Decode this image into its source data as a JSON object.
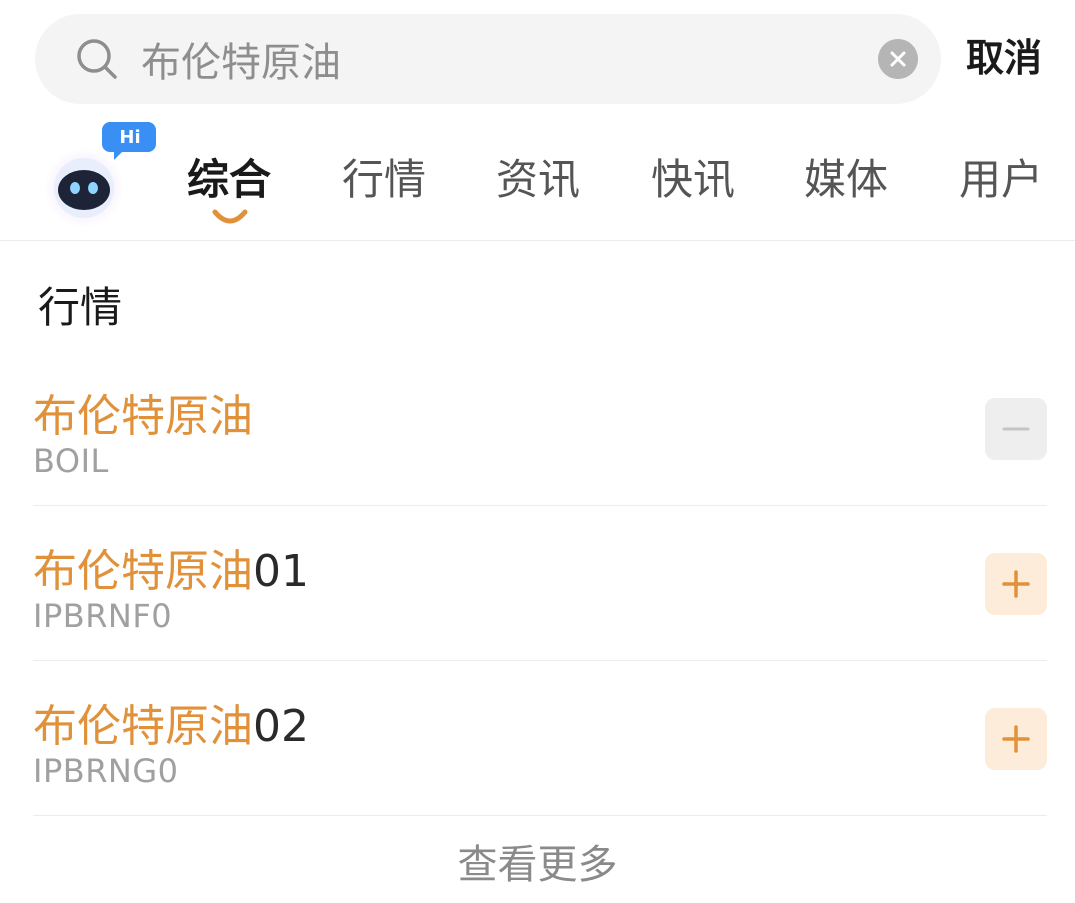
{
  "search": {
    "value": "布伦特原油",
    "placeholder": "",
    "cancel_label": "取消"
  },
  "assistant": {
    "badge": "Hi"
  },
  "tabs": [
    {
      "label": "综合",
      "active": true
    },
    {
      "label": "行情",
      "active": false
    },
    {
      "label": "资讯",
      "active": false
    },
    {
      "label": "快讯",
      "active": false
    },
    {
      "label": "媒体",
      "active": false
    },
    {
      "label": "用户",
      "active": false
    }
  ],
  "section": {
    "title": "行情",
    "items": [
      {
        "highlight": "布伦特原油",
        "suffix": "",
        "code": "BOIL",
        "action": "remove",
        "action_icon": "minus-icon"
      },
      {
        "highlight": "布伦特原油",
        "suffix": "01",
        "code": "IPBRNF0",
        "action": "add",
        "action_icon": "plus-icon"
      },
      {
        "highlight": "布伦特原油",
        "suffix": "02",
        "code": "IPBRNG0",
        "action": "add",
        "action_icon": "plus-icon"
      }
    ],
    "more_label": "查看更多"
  },
  "colors": {
    "accent": "#e0913a",
    "accent_bg": "#fcecd9",
    "search_bg": "#f4f4f4",
    "muted_text": "#a0a0a0"
  }
}
